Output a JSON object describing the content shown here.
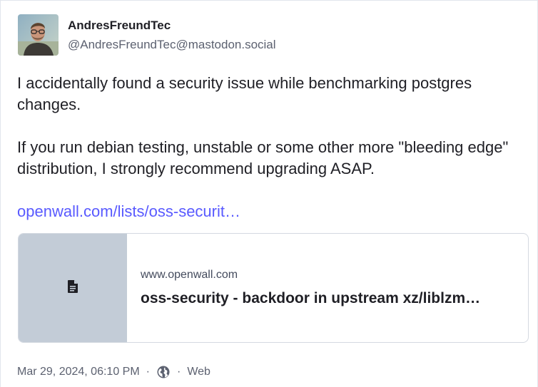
{
  "author": {
    "display_name": "AndresFreundTec",
    "handle": "@AndresFreundTec@mastodon.social"
  },
  "post": {
    "paragraph1": "I accidentally found a security issue while benchmarking postgres changes.",
    "paragraph2": "If you run debian testing, unstable or some other more \"bleeding edge\" distribution, I strongly recommend upgrading ASAP.",
    "link_text": "openwall.com/lists/oss-securit…"
  },
  "card": {
    "thumb_icon": "file-icon",
    "host": "www.openwall.com",
    "title": "oss-security - backdoor in upstream xz/liblzm…"
  },
  "meta": {
    "timestamp": "Mar 29, 2024, 06:10 PM",
    "separator": "·",
    "visibility_icon": "globe-icon",
    "application": "Web"
  },
  "colors": {
    "link": "#595aff",
    "text": "#1f1f25",
    "muted": "#5c6170",
    "thumb_bg": "#c3ccd7"
  }
}
